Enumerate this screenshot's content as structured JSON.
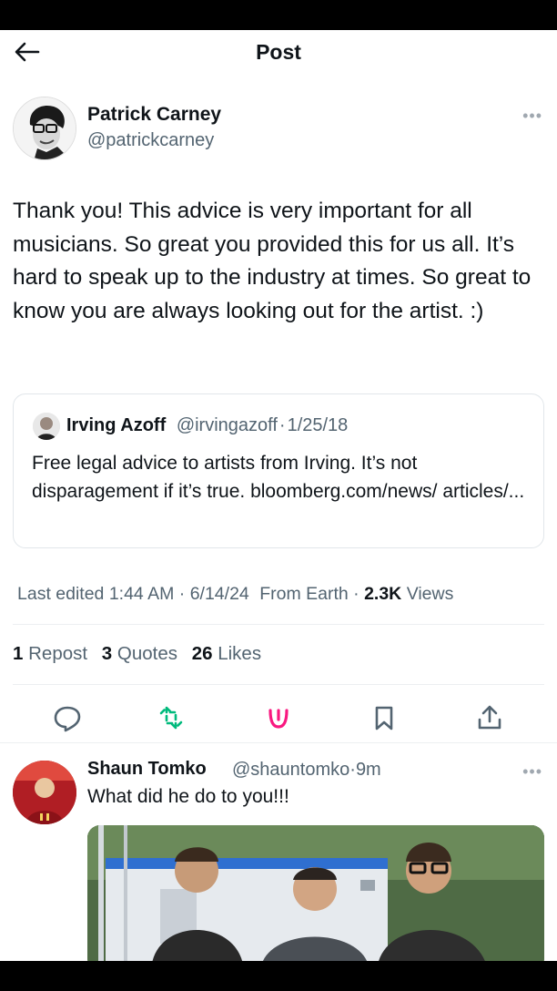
{
  "header": {
    "title": "Post"
  },
  "post": {
    "author_name": "Patrick Carney",
    "author_handle": "@patrickcarney",
    "more": "•••",
    "text": "Thank you! This advice is very important for all musicians. So great you provided this for us all. It’s hard to speak up to the industry at times. So great to know you are always looking out for the artist. :)"
  },
  "quote": {
    "author_name": "Irving Azoff",
    "author_handle": "@irvingazoff",
    "separator": "·",
    "date": "1/25/18",
    "text": "Free legal advice to artists from Irving.  It’s not disparagement if it’s true. bloomberg.com/news/ articles/..."
  },
  "meta": {
    "edited": "Last edited 1:44 AM · 6/14/24",
    "source": "From Earth",
    "separator": "·",
    "views_count": "2.3K",
    "views_label": "Views"
  },
  "stats": {
    "reposts_count": "1",
    "reposts_label": "Repost",
    "quotes_count": "3",
    "quotes_label": "Quotes",
    "likes_count": "26",
    "likes_label": "Likes"
  },
  "actions": {
    "icons": [
      "reply-icon",
      "repost-icon",
      "like-icon",
      "bookmark-icon",
      "share-icon"
    ],
    "like_color": "#f91880"
  },
  "reply": {
    "author_name": "Shaun Tomko",
    "author_handle": "@shauntomko",
    "separator": "·",
    "time": "9m",
    "more": "•••",
    "text": "What did he do to you!!!"
  },
  "colors": {
    "text": "#0f1419",
    "muted": "#536471",
    "border": "#e1e6ea"
  }
}
